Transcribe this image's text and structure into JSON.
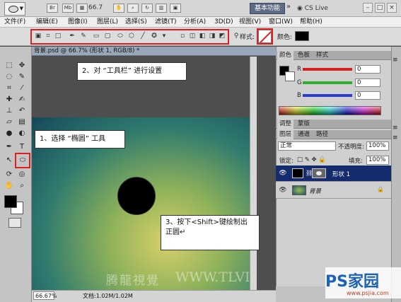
{
  "app": {
    "logo": "Ps",
    "zoom_display": "66.7",
    "workspace_label": "基本功能",
    "more": "»",
    "cs_live": "CS Live",
    "top_icons": [
      "Br",
      "Mb"
    ]
  },
  "menu": [
    "文件(F)",
    "编辑(E)",
    "图像(I)",
    "图层(L)",
    "选择(S)",
    "滤镜(T)",
    "分析(A)",
    "3D(D)",
    "视图(V)",
    "窗口(W)",
    "帮助(H)"
  ],
  "options_bar": {
    "style_label": "样式:",
    "color_label": "颜色:"
  },
  "document": {
    "tab_title": "背景.psd @ 66.7% (形状 1, RGB/8) *",
    "zoom_status": "66.67%",
    "doc_info": "文档:1.02M/1.02M"
  },
  "callouts": {
    "c1": "1、选择 “椭圆” 工具",
    "c2": "2、对 “工具栏” 进行设置",
    "c3_line1": "3、按下<Shift>键绘制出",
    "c3_line2": "正圆↵"
  },
  "color_panel": {
    "tabs": [
      "颜色",
      "色板",
      "样式"
    ],
    "r_label": "R",
    "g_label": "G",
    "b_label": "B",
    "r": "0",
    "g": "0",
    "b": "0",
    "colors": {
      "r": "#d42020",
      "g": "#2fae2f",
      "b": "#2a3fcf"
    }
  },
  "adjust_panel": {
    "tabs": [
      "调整",
      "蒙版"
    ]
  },
  "layers_panel": {
    "tabs": [
      "图层",
      "通道",
      "路径"
    ],
    "blend_mode": "正常",
    "opacity_label": "不透明度:",
    "opacity": "100%",
    "lock_label": "锁定:",
    "fill_label": "填充:",
    "fill": "100%",
    "layers": [
      {
        "name": "形状 1",
        "selected": true
      },
      {
        "name": "背景",
        "locked": true
      }
    ]
  },
  "watermarks": {
    "cn": "腾龍視覺",
    "latin": "WWW.TLVI",
    "site_logo": "PS家园",
    "site_sub": "www.psjia.com"
  }
}
